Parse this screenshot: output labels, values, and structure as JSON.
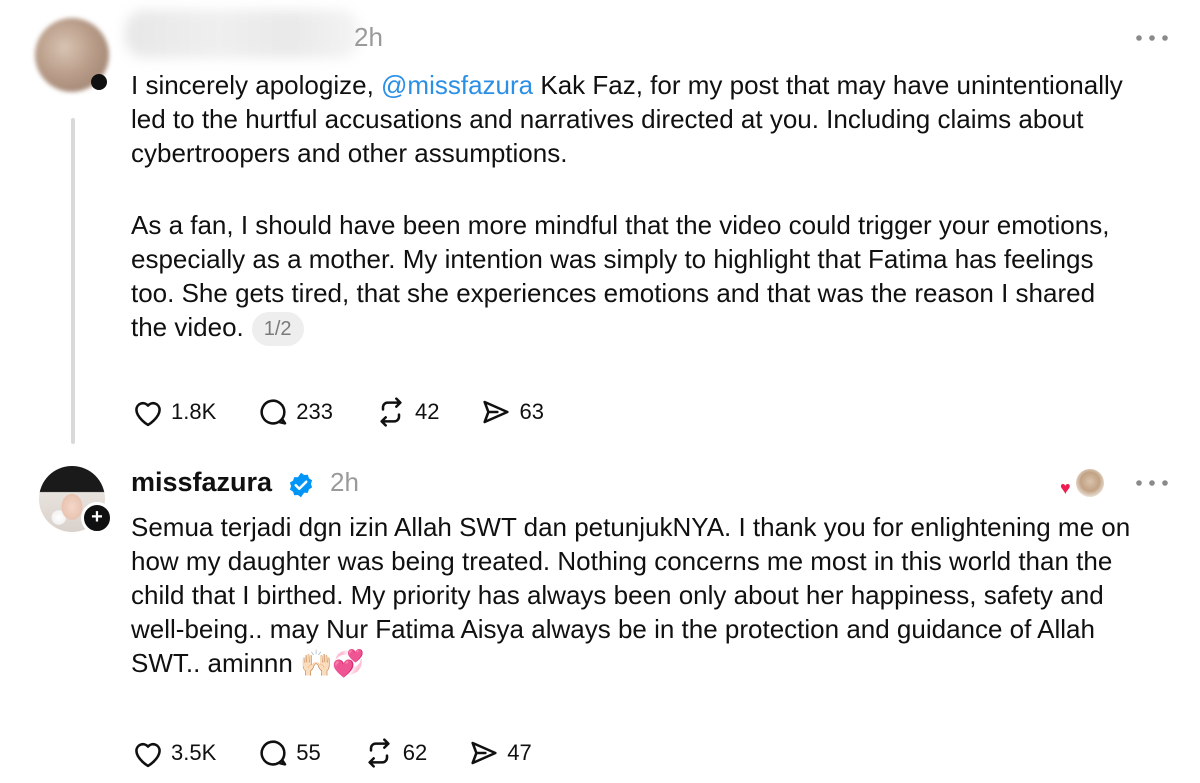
{
  "post1": {
    "time": "2h",
    "paragraph1": {
      "before": "I sincerely apologize, ",
      "mention": "@missfazura",
      "after": " Kak Faz, for my post that may have unintentionally led to the hurtful accusations and narratives directed at you. Including claims about cybertroopers and other assumptions."
    },
    "paragraph2": "As a fan, I should have been more mindful that the video could trigger your emotions, especially as a mother. My intention was simply to highlight that Fatima has feelings too. She gets tired, that she experiences emotions and that was the reason I shared the video.",
    "pager": "1/2",
    "likes": "1.8K",
    "replies": "233",
    "reposts": "42",
    "shares": "63"
  },
  "post2": {
    "username": "missfazura",
    "time": "2h",
    "text": "Semua terjadi dgn izin Allah SWT dan petunjukNYA. I thank you for enlightening me on how my daughter was being treated. Nothing concerns me most in this world than the child that I birthed. My priority has always been only about her happiness, safety and well-being.. may Nur Fatima Aisya always be in the protection and guidance of Allah SWT.. aminnn",
    "emoji": "🙌🏻💞",
    "likes": "3.5K",
    "replies": "55",
    "reposts": "62",
    "shares": "47"
  },
  "icons": [
    "more-icon",
    "heart-icon",
    "comment-icon",
    "repost-icon",
    "share-icon",
    "verified-icon",
    "follow-plus-icon"
  ],
  "colors": {
    "mention": "#2b8fe6",
    "verified": "#0095f6",
    "meta_gray": "#9a9a9a",
    "heart": "#ee1d52"
  }
}
